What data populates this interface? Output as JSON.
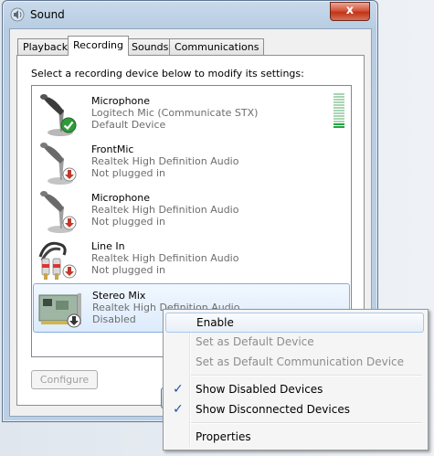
{
  "window": {
    "title": "Sound",
    "close_glyph": "x"
  },
  "tabs": [
    {
      "label": "Playback",
      "active": false
    },
    {
      "label": "Recording",
      "active": true
    },
    {
      "label": "Sounds",
      "active": false
    },
    {
      "label": "Communications",
      "active": false
    }
  ],
  "instruction": "Select a recording device below to modify its settings:",
  "devices": [
    {
      "name": "Microphone",
      "driver": "Logitech Mic (Communicate STX)",
      "status": "Default Device",
      "icon": "microphone-icon",
      "badge": "default-check-badge",
      "level_fraction": 0.1
    },
    {
      "name": "FrontMic",
      "driver": "Realtek High Definition Audio",
      "status": "Not plugged in",
      "icon": "microphone-icon",
      "badge": "unplugged-arrow-badge"
    },
    {
      "name": "Microphone",
      "driver": "Realtek High Definition Audio",
      "status": "Not plugged in",
      "icon": "microphone-icon",
      "badge": "unplugged-arrow-badge"
    },
    {
      "name": "Line In",
      "driver": "Realtek High Definition Audio",
      "status": "Not plugged in",
      "icon": "line-in-cable-icon",
      "badge": "unplugged-arrow-badge"
    },
    {
      "name": "Stereo Mix",
      "driver": "Realtek High Definition Audio",
      "status": "Disabled",
      "icon": "sound-card-icon",
      "badge": "disabled-arrow-badge",
      "selected": true
    }
  ],
  "buttons": {
    "configure": "Configure"
  },
  "context_menu": {
    "items": [
      {
        "label": "Enable",
        "enabled": true,
        "checked": false,
        "hover": true
      },
      {
        "label": "Set as Default Device",
        "enabled": false,
        "checked": false
      },
      {
        "label": "Set as Default Communication Device",
        "enabled": false,
        "checked": false
      },
      {
        "label": "Show Disabled Devices",
        "enabled": true,
        "checked": true
      },
      {
        "label": "Show Disconnected Devices",
        "enabled": true,
        "checked": true
      },
      {
        "label": "Properties",
        "enabled": true,
        "checked": false
      }
    ]
  },
  "colors": {
    "accent": "#2050b0",
    "level_on": "#1fa53e",
    "close_red": "#c03416",
    "selection": "#dcebfc"
  }
}
